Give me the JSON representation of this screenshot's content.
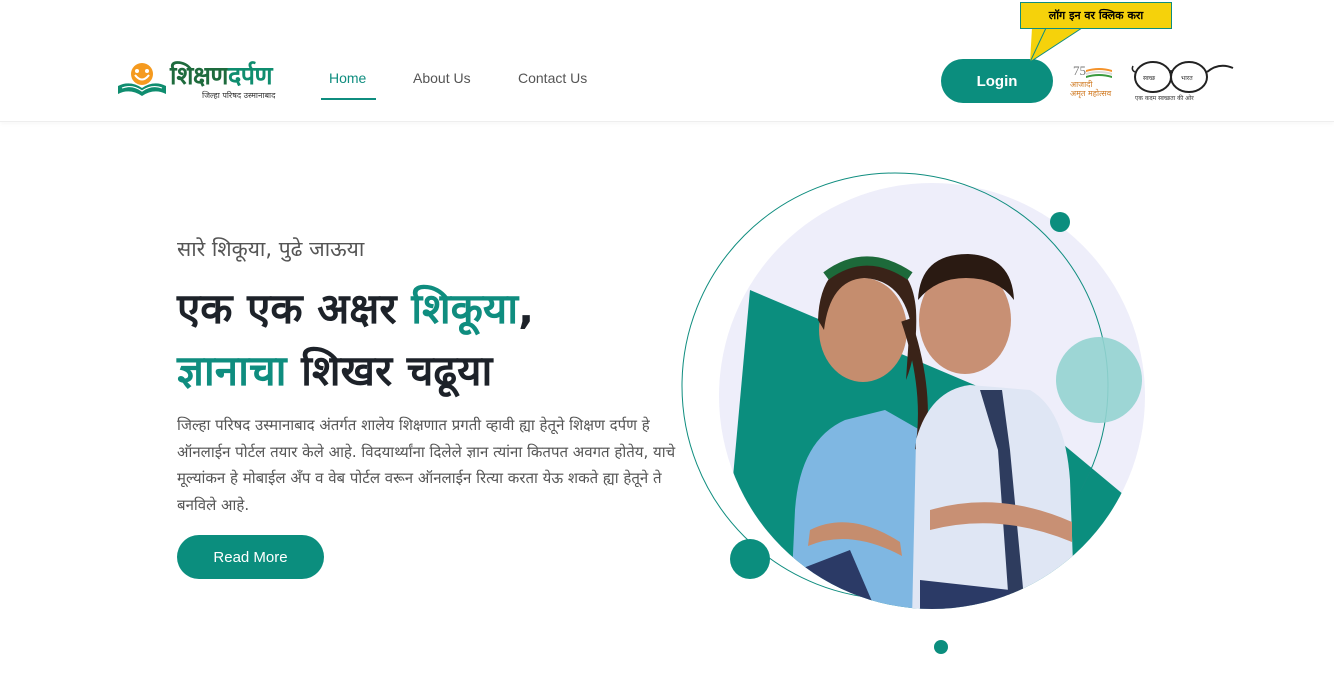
{
  "header": {
    "logo_title_main": "शिक्षण",
    "logo_title_accent": "दर्पण",
    "logo_subtitle": "जिल्हा परिषद उस्मानाबाद",
    "nav": [
      {
        "label": "Home",
        "active": true
      },
      {
        "label": "About Us",
        "active": false
      },
      {
        "label": "Contact Us",
        "active": false
      }
    ],
    "login_label": "Login",
    "login_callout": "लॉग इन वर क्लिक करा",
    "azadi_number": "75",
    "azadi_text_line1": "आजादी",
    "azadi_text_line2": "अमृत महोत्सव",
    "swachh_caption": "एक कदम स्वच्छता की ओर"
  },
  "hero": {
    "kicker": "सारे शिकूया, पुढे जाऊया",
    "headline_line1_a": "एक एक अक्षर",
    "headline_line1_b": "शिकूया",
    "headline_line1_c": ",",
    "headline_line2_a": "ज्ञानाचा",
    "headline_line2_b": "शिखर चढूया",
    "description": "जिल्हा परिषद उस्मानाबाद अंतर्गत शालेय शिक्षणात प्रगती व्हावी ह्या हेतूने शिक्षण दर्पण हे ऑनलाईन पोर्टल तयार केले आहे. विदयार्थ्यांना दिलेले ज्ञान त्यांना कितपत अवगत होतेय, याचे मूल्यांकन हे मोबाईल अँप व वेब पोर्टल वरून ऑनलाईन रित्या करता येऊ शकते ह्या हेतूने ते बनविले आहे.",
    "read_more_label": "Read More"
  },
  "colors": {
    "primary": "#0b8e7e",
    "callout_bg": "#f5d20b",
    "headline": "#1d2229",
    "circle_light": "#eeeefa",
    "circle_mint": "#93d3d0"
  }
}
